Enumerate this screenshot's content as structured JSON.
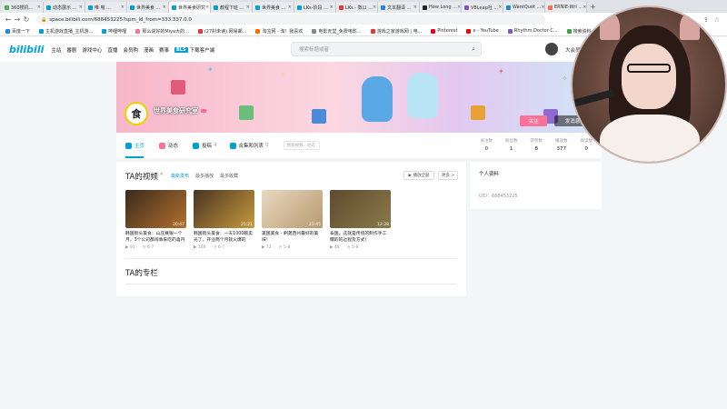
{
  "browser": {
    "tabs": [
      {
        "label": "360搜机...",
        "color": "#4caf50"
      },
      {
        "label": "动态展示 ...",
        "color": "#00a1d6"
      },
      {
        "label": "唯 嗯 ...",
        "color": "#00a1d6"
      },
      {
        "label": "世界美食 ...",
        "color": "#00a1d6"
      },
      {
        "label": "世界美食研究",
        "color": "#00a1d6",
        "active": true
      },
      {
        "label": "教程下班 ...",
        "color": "#00a1d6"
      },
      {
        "label": "世界美食 ...",
        "color": "#00a1d6"
      },
      {
        "label": "LKs-阶段 ...",
        "color": "#00a1d6"
      },
      {
        "label": "LKs - 数以 ...",
        "color": "#e53935"
      },
      {
        "label": "文本翻译 ...",
        "color": "#1e88e5"
      },
      {
        "label": "How Long ...",
        "color": "#222222"
      },
      {
        "label": "VBLeap社 ...",
        "color": "#7e57c2"
      },
      {
        "label": "WantQuot ...",
        "color": "#1e88e5"
      },
      {
        "label": "ERNIE-Wri ...",
        "color": "#ff7043"
      }
    ],
    "new_tab": "+",
    "url": "space.bilibili.com/688453225?spm_id_from=333.337.0.0",
    "bookmarks": [
      {
        "label": "百度一下",
        "color": "#1e88e5"
      },
      {
        "label": "主机游戏直播_主机游...",
        "color": "#00a1d6"
      },
      {
        "label": "哔哩哔哩",
        "color": "#00a1d6"
      },
      {
        "label": "那么说好的Miya大的...",
        "color": "#fb7299"
      },
      {
        "label": "(27封未读) 网易邮...",
        "color": "#e53935"
      },
      {
        "label": "淘宝网 - 淘！我喜欢",
        "color": "#ff6d00"
      },
      {
        "label": "电影天堂_免费电影...",
        "color": "#888888"
      },
      {
        "label": "游戏之家游戏网 | 电...",
        "color": "#e53935"
      },
      {
        "label": "Pinterest",
        "color": "#e60023"
      },
      {
        "label": "e - YouTube",
        "color": "#ff0000"
      },
      {
        "label": "Rhythm Doctor C...",
        "color": "#7e57c2"
      },
      {
        "label": "搜索资料、网盘搜...",
        "color": "#43a047"
      }
    ]
  },
  "bili": {
    "logo": "bilibili",
    "nav": [
      "主站",
      "番剧",
      "游戏中心",
      "直播",
      "会员购",
      "漫画",
      "赛事"
    ],
    "download_badge": "BLS",
    "download": "下载客户端",
    "search_placeholder": "搜索标题或者",
    "header_right": "大会员"
  },
  "profile": {
    "avatar_char": "食",
    "name": "世界美食研究室",
    "follow": "关注",
    "message": "发消息",
    "tabs": [
      {
        "label": "主页",
        "count": "",
        "color": "#00a1d6",
        "active": true
      },
      {
        "label": "动态",
        "count": "",
        "color": "#fb7299"
      },
      {
        "label": "投稿",
        "count": "4",
        "color": "#00a1d6"
      },
      {
        "label": "合集和列表",
        "count": "0",
        "color": "#00a1d6"
      }
    ],
    "search_placeholder": "搜索视频、动态",
    "stats": [
      {
        "label": "关注数",
        "value": "0"
      },
      {
        "label": "粉丝数",
        "value": "1"
      },
      {
        "label": "获赞数",
        "value": "8"
      },
      {
        "label": "播放数",
        "value": "377"
      },
      {
        "label": "阅读数",
        "value": "0"
      }
    ]
  },
  "videos_section": {
    "title": "TA的视频",
    "count": "4",
    "sorts": [
      "最新发布",
      "最多播放",
      "最多收藏"
    ],
    "play_all": "▶ 播放全部",
    "more": "更多 >",
    "videos": [
      {
        "title": "韩国街头美食：山庄赛银一个月，3个公司都闹事来吃的喜月",
        "duration": "20:47",
        "plays": "91",
        "time": "6-7",
        "colors": [
          "#3a2a1e",
          "#b3702d"
        ]
      },
      {
        "title": "韩国街头美食：一天1000碗卖光了，开业两个月就火爆的",
        "duration": "21:21",
        "plays": "166",
        "time": "6-7",
        "colors": [
          "#4a3322",
          "#c79a3d"
        ]
      },
      {
        "title": "美国美食 - 刷弟西州最好的美味！",
        "duration": "23:45",
        "plays": "72",
        "time": "5-8",
        "colors": [
          "#e8d9c0",
          "#b89a70"
        ]
      },
      {
        "title": "泰国，这就是传统的制作手工糯的的过程及方式！",
        "duration": "12:28",
        "plays": "48",
        "time": "5-8",
        "colors": [
          "#5e4a2e",
          "#8a7a4a"
        ]
      }
    ]
  },
  "column_section": {
    "title": "TA的专栏"
  },
  "side": {
    "title": "个人资料",
    "uid": "UID：688453225"
  }
}
